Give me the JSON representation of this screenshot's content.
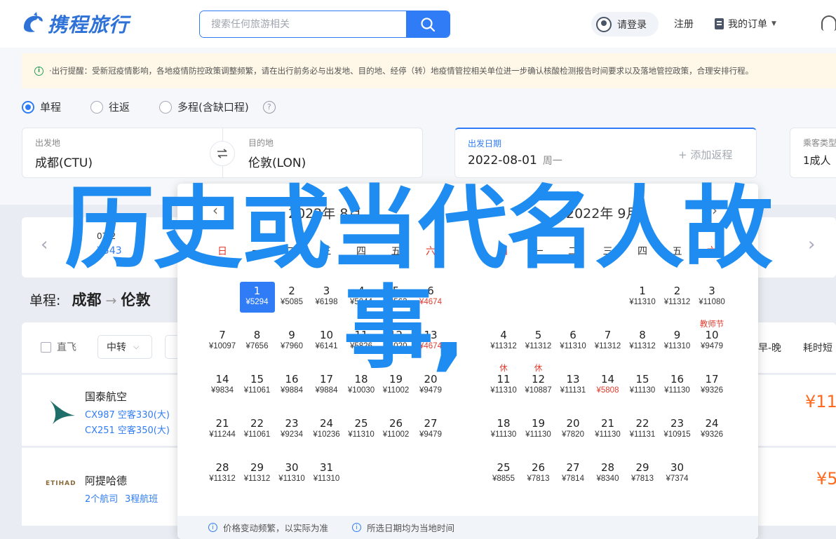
{
  "brand": {
    "name": "携程旅行"
  },
  "search": {
    "placeholder": "搜索任何旅游相关"
  },
  "nav": {
    "login": "请登录",
    "register": "注册",
    "orders": "我的订单"
  },
  "notice": {
    "text": "·出行提醒：受新冠疫情影响，各地疫情防控政策调整频繁，请在出行前务必与出发地、目的地、经停（转）地疫情管控相关单位进一步确认核酸检测报告时间要求以及落地管控政策，合理安排行程。"
  },
  "trip_types": [
    {
      "label": "单程",
      "selected": true
    },
    {
      "label": "往返",
      "selected": false
    },
    {
      "label": "多程(含缺口程)",
      "selected": false
    }
  ],
  "form": {
    "from_label": "出发地",
    "from_value": "成都(CTU)",
    "to_label": "目的地",
    "to_value": "伦敦(LON)",
    "date_label": "出发日期",
    "date_value": "2022-08-01",
    "date_weekday": "周一",
    "return_add": "+ 添加返程",
    "pax_label": "乘客类型",
    "pax_value": "1成人"
  },
  "strip": {
    "date": "07-2",
    "price": "¥543"
  },
  "route": {
    "prefix": "单程:",
    "from": "成都",
    "to": "伦敦"
  },
  "filters": {
    "nonstop": "直飞",
    "transfer": "中转",
    "sort_early_late": "早-晚",
    "sort_duration": "耗时短"
  },
  "flights": [
    {
      "airline": "国泰航空",
      "line1": "CX987 空客330(大)",
      "line2": "CX251 空客350(大)",
      "price": "¥11"
    },
    {
      "airline": "阿提哈德",
      "line1": "2个航司",
      "line2": "3程航班",
      "price": "¥5"
    }
  ],
  "calendar": {
    "weekdays": [
      "日",
      "一",
      "二",
      "三",
      "四",
      "五",
      "六"
    ],
    "months": [
      {
        "title": "2022年 8月",
        "days": [
          {
            "d": "1",
            "p": "¥5294",
            "sel": true
          },
          {
            "d": "2",
            "p": "¥5085"
          },
          {
            "d": "3",
            "p": "¥6198"
          },
          {
            "d": "4",
            "p": "¥5044"
          },
          {
            "d": "5",
            "p": "¥8563"
          },
          {
            "d": "6",
            "p": "¥4674",
            "low": true
          },
          {
            "d": "7",
            "p": "¥10097"
          },
          {
            "d": "8",
            "p": "¥7656"
          },
          {
            "d": "9",
            "p": "¥7960"
          },
          {
            "d": "10",
            "p": "¥6141"
          },
          {
            "d": "11",
            "p": "¥5826"
          },
          {
            "d": "12",
            "p": "¥6020"
          },
          {
            "d": "13",
            "p": "¥4674",
            "low": true
          },
          {
            "d": "14",
            "p": "¥9834"
          },
          {
            "d": "15",
            "p": "¥11061"
          },
          {
            "d": "16",
            "p": "¥9884"
          },
          {
            "d": "17",
            "p": "¥9884"
          },
          {
            "d": "18",
            "p": "¥10030"
          },
          {
            "d": "19",
            "p": "¥11002"
          },
          {
            "d": "20",
            "p": "¥9479"
          },
          {
            "d": "21",
            "p": "¥11244"
          },
          {
            "d": "22",
            "p": "¥11061"
          },
          {
            "d": "23",
            "p": "¥9234"
          },
          {
            "d": "24",
            "p": "¥10236"
          },
          {
            "d": "25",
            "p": "¥11310"
          },
          {
            "d": "26",
            "p": "¥11002"
          },
          {
            "d": "27",
            "p": "¥9479"
          },
          {
            "d": "28",
            "p": "¥11312"
          },
          {
            "d": "29",
            "p": "¥11312"
          },
          {
            "d": "30",
            "p": "¥11310"
          },
          {
            "d": "31",
            "p": "¥11310"
          }
        ]
      },
      {
        "title": "2022年 9月",
        "days": [
          {
            "d": "1",
            "p": "¥11310"
          },
          {
            "d": "2",
            "p": "¥11312"
          },
          {
            "d": "3",
            "p": "¥11080"
          },
          {
            "d": "4",
            "p": "¥11312"
          },
          {
            "d": "5",
            "p": "¥11312"
          },
          {
            "d": "6",
            "p": "¥11310"
          },
          {
            "d": "7",
            "p": "¥11312"
          },
          {
            "d": "8",
            "p": "¥11312"
          },
          {
            "d": "9",
            "p": "¥11310"
          },
          {
            "d": "10",
            "p": "¥9479",
            "tag": "教师节"
          },
          {
            "d": "11",
            "p": "¥11310",
            "tag": "休"
          },
          {
            "d": "12",
            "p": "¥10887",
            "tag": "休"
          },
          {
            "d": "13",
            "p": "¥11131"
          },
          {
            "d": "14",
            "p": "¥5808",
            "low": true
          },
          {
            "d": "15",
            "p": "¥11130"
          },
          {
            "d": "16",
            "p": "¥11130"
          },
          {
            "d": "17",
            "p": "¥9326"
          },
          {
            "d": "18",
            "p": "¥11130"
          },
          {
            "d": "19",
            "p": "¥11130"
          },
          {
            "d": "20",
            "p": "¥7820"
          },
          {
            "d": "21",
            "p": "¥11130"
          },
          {
            "d": "22",
            "p": "¥11131"
          },
          {
            "d": "23",
            "p": "¥10915"
          },
          {
            "d": "24",
            "p": "¥9326"
          },
          {
            "d": "25",
            "p": "¥8855"
          },
          {
            "d": "26",
            "p": "¥7813"
          },
          {
            "d": "27",
            "p": "¥7814"
          },
          {
            "d": "28",
            "p": "¥8340"
          },
          {
            "d": "29",
            "p": "¥7813"
          },
          {
            "d": "30",
            "p": "¥7374"
          }
        ]
      }
    ],
    "footer": [
      "价格变动频繁，以实际为准",
      "所选日期均为当地时间"
    ]
  },
  "overlay_text": "历史或当代名人故事,",
  "colors": {
    "accent": "#2f7cf6",
    "price_low": "#e23b2e",
    "overlay": "#1e8cf0",
    "notice_bg": "#fff8e8"
  },
  "icons": [
    "logo-dolphin-icon",
    "search-icon",
    "user-icon",
    "order-icon",
    "chevron-down-icon",
    "headset-icon",
    "info-icon",
    "help-icon",
    "swap-icon",
    "chevron-left-icon",
    "chevron-right-icon"
  ]
}
